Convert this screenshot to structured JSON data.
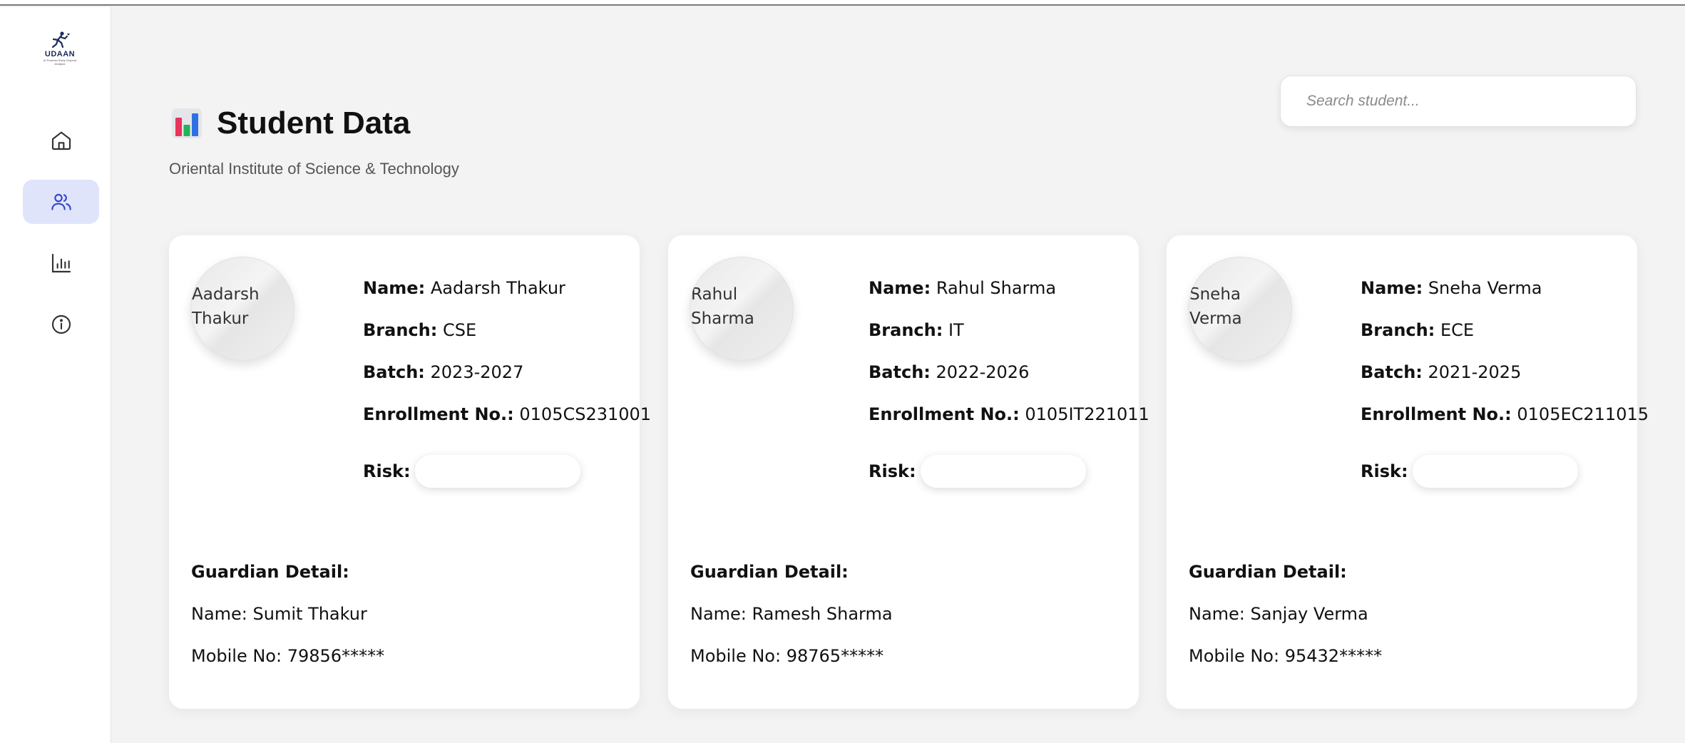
{
  "app": {
    "logo_text": "UDAAN",
    "logo_tagline": "AI Powered Early Dropout Analysis"
  },
  "sidebar": {
    "items": [
      {
        "icon": "home-icon",
        "active": false
      },
      {
        "icon": "users-icon",
        "active": true
      },
      {
        "icon": "bar-chart-icon",
        "active": false
      },
      {
        "icon": "info-icon",
        "active": false
      }
    ]
  },
  "header": {
    "title": "Student Data",
    "icon": "bar-chart-emoji-icon",
    "subtitle": "Oriental Institute of Science & Technology"
  },
  "search": {
    "placeholder": "Search student...",
    "value": ""
  },
  "labels": {
    "name": "Name:",
    "branch": "Branch:",
    "batch": "Batch:",
    "enrollment": "Enrollment No.:",
    "risk": "Risk:",
    "guardian_heading": "Guardian Detail:",
    "guardian_name_prefix": "Name:",
    "mobile_prefix": "Mobile No:"
  },
  "students": [
    {
      "photo_alt": "Aadarsh Thakur",
      "name": "Aadarsh Thakur",
      "branch": "CSE",
      "batch": "2023-2027",
      "enrollment": "0105CS231001",
      "risk": "",
      "guardian_name": "Sumit Thakur",
      "guardian_mobile": "79856*****"
    },
    {
      "photo_alt": "Rahul Sharma",
      "name": "Rahul Sharma",
      "branch": "IT",
      "batch": "2022-2026",
      "enrollment": "0105IT221011",
      "risk": "",
      "guardian_name": "Ramesh Sharma",
      "guardian_mobile": "98765*****"
    },
    {
      "photo_alt": "Sneha Verma",
      "name": "Sneha Verma",
      "branch": "ECE",
      "batch": "2021-2025",
      "enrollment": "0105EC211015",
      "risk": "",
      "guardian_name": "Sanjay Verma",
      "guardian_mobile": "95432*****"
    }
  ],
  "colors": {
    "active_nav_bg": "#dfe4fb",
    "accent": "#3346c8"
  }
}
